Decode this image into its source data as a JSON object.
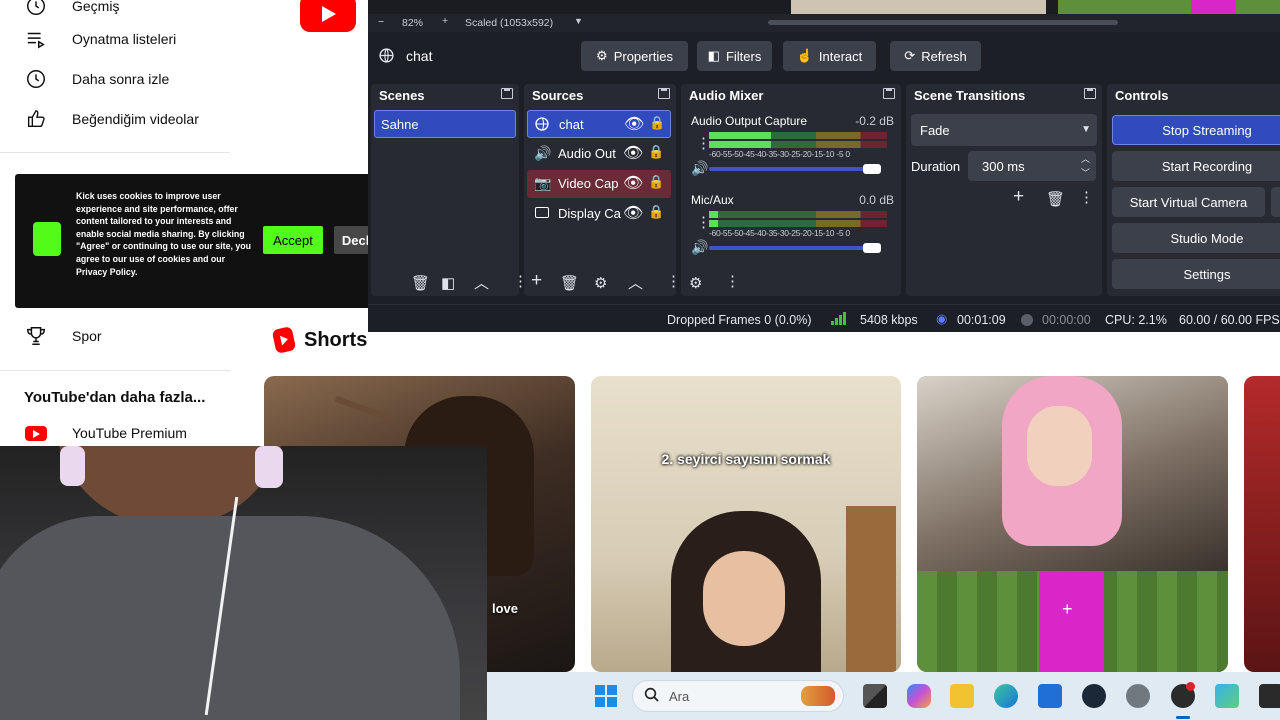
{
  "youtube": {
    "sidebar": {
      "partial_top_item": "Geçmiş",
      "items": [
        {
          "label": "Oynatma listeleri",
          "icon": "playlist-icon"
        },
        {
          "label": "Daha sonra izle",
          "icon": "clock-icon"
        },
        {
          "label": "Beğendiğim videolar",
          "icon": "thumbs-up-icon"
        }
      ],
      "spor": "Spor",
      "more_heading": "YouTube'dan daha fazla...",
      "premium": "YouTube Premium"
    },
    "shorts_title": "Shorts",
    "shorts": [
      {
        "caption": "love"
      },
      {
        "caption": "2. seyirci sayısını sormak"
      },
      {
        "caption": ""
      }
    ]
  },
  "cookie_banner": {
    "text": "Kick uses cookies to improve user experience and site performance, offer content tailored to your interests and enable social media sharing. By clicking \"Agree\" or continuing to use our site, you agree to our use of cookies and our Privacy Policy.",
    "accept": "Accept",
    "decline": "Decline"
  },
  "obs": {
    "preview": {
      "zoom": "82%",
      "scaled": "Scaled (1053x592)"
    },
    "source_bar": {
      "name": "chat",
      "properties": "Properties",
      "filters": "Filters",
      "interact": "Interact",
      "refresh": "Refresh"
    },
    "scenes": {
      "title": "Scenes",
      "items": [
        "Sahne"
      ]
    },
    "sources": {
      "title": "Sources",
      "items": [
        {
          "name": "chat",
          "icon": "globe-icon"
        },
        {
          "name": "Audio Out",
          "icon": "speaker-icon"
        },
        {
          "name": "Video Cap",
          "icon": "camera-icon"
        },
        {
          "name": "Display Ca",
          "icon": "monitor-icon"
        }
      ]
    },
    "audio_mixer": {
      "title": "Audio Mixer",
      "ticks": "-60-55-50-45-40-35-30-25-20-15-10 -5  0",
      "channels": [
        {
          "name": "Audio Output Capture",
          "db": "-0.2 dB",
          "level": 0.35,
          "volume": 1.0
        },
        {
          "name": "Mic/Aux",
          "db": "0.0 dB",
          "level": 0.05,
          "volume": 1.0
        }
      ]
    },
    "scene_transitions": {
      "title": "Scene Transitions",
      "transition": "Fade",
      "duration_label": "Duration",
      "duration": "300 ms"
    },
    "controls": {
      "title": "Controls",
      "buttons": [
        "Stop Streaming",
        "Start Recording",
        "Start Virtual Camera",
        "Studio Mode",
        "Settings"
      ]
    },
    "status": {
      "dropped": "Dropped Frames 0 (0.0%)",
      "bitrate": "5408 kbps",
      "stream_time": "00:01:09",
      "rec_time": "00:00:00",
      "cpu": "CPU: 2.1%",
      "fps": "60.00 / 60.00 FPS"
    }
  },
  "taskbar": {
    "search_placeholder": "Ara"
  }
}
